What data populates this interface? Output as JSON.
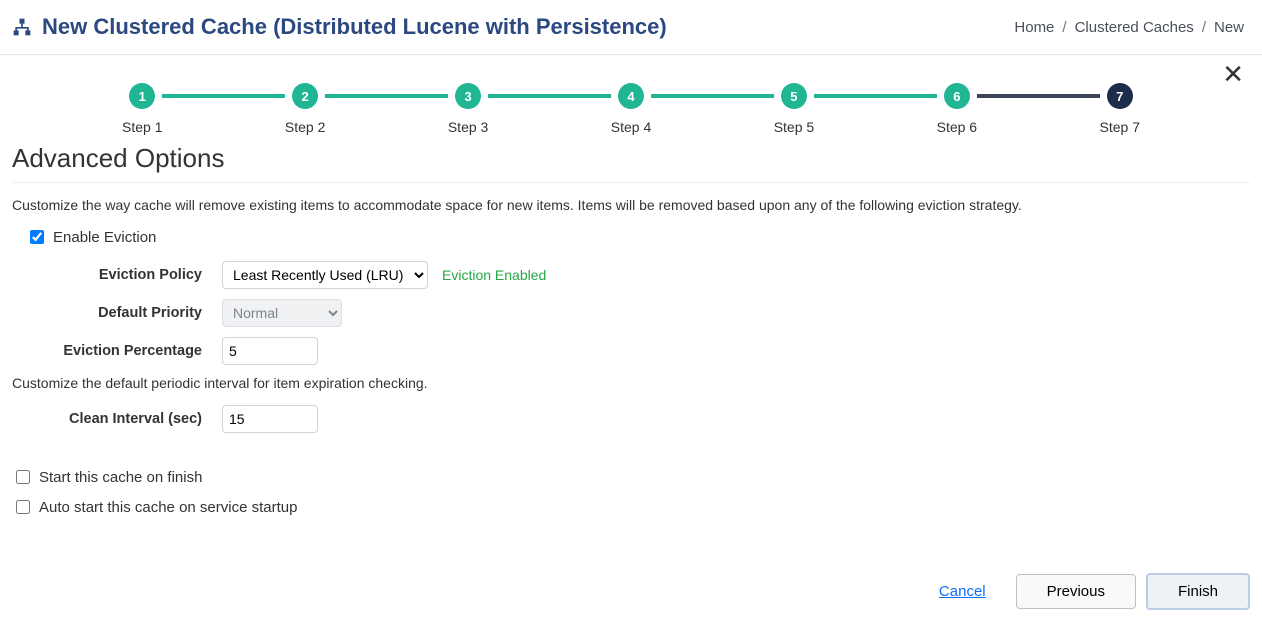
{
  "header": {
    "title": "New Clustered Cache (Distributed Lucene with Persistence)"
  },
  "breadcrumb": {
    "home": "Home",
    "caches": "Clustered Caches",
    "new": "New"
  },
  "stepper": {
    "steps": [
      {
        "num": "1",
        "label": "Step 1"
      },
      {
        "num": "2",
        "label": "Step 2"
      },
      {
        "num": "3",
        "label": "Step 3"
      },
      {
        "num": "4",
        "label": "Step 4"
      },
      {
        "num": "5",
        "label": "Step 5"
      },
      {
        "num": "6",
        "label": "Step 6"
      },
      {
        "num": "7",
        "label": "Step 7"
      }
    ],
    "current_index": 6
  },
  "section": {
    "title": "Advanced Options",
    "eviction_desc": "Customize the way cache will remove existing items to accommodate space for new items. Items will be removed based upon any of the following eviction strategy.",
    "enable_eviction_label": "Enable Eviction",
    "interval_desc": "Customize the default periodic interval for item expiration checking."
  },
  "form": {
    "eviction_policy_label": "Eviction Policy",
    "eviction_policy_value": "Least Recently Used (LRU)",
    "eviction_hint": "Eviction Enabled",
    "default_priority_label": "Default Priority",
    "default_priority_value": "Normal",
    "eviction_percentage_label": "Eviction Percentage",
    "eviction_percentage_value": "5",
    "clean_interval_label": "Clean Interval (sec)",
    "clean_interval_value": "15"
  },
  "bottom": {
    "start_on_finish": "Start this cache on finish",
    "auto_start": "Auto start this cache on service startup"
  },
  "footer": {
    "cancel": "Cancel",
    "previous": "Previous",
    "finish": "Finish"
  }
}
